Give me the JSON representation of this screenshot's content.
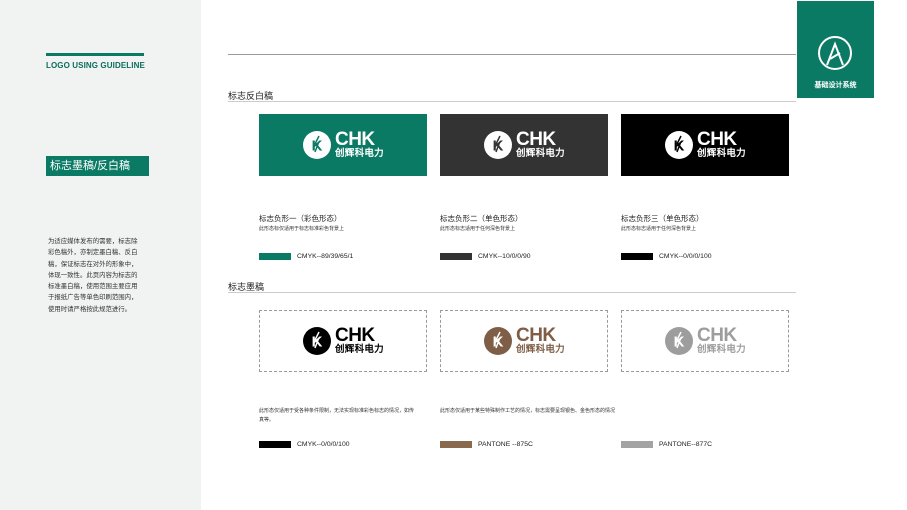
{
  "sidebar": {
    "guideline_title": "LOGO USING GUIDELINE",
    "section_tag": "标志墨稿/反白稿",
    "description_lines": [
      "为适应媒体发布的需要，标志除",
      "彩色稿外，亦制定墨白稿、反白",
      "稿，保证标志在对外的形象中，",
      "体现一致性。此页内容为标志的",
      "标准墨白稿，使用范围主要应用",
      "于报纸广告等单色印刷范围内，",
      "使用时请严格按此规范进行。"
    ]
  },
  "badge": {
    "label": "基础设计系统",
    "icon": "letter-a-circle-icon"
  },
  "logo": {
    "wordmark": "CHK",
    "cn_name": "创辉科电力"
  },
  "reverse_section": {
    "title": "标志反白稿",
    "cards": [
      {
        "bg": "#0b7a64",
        "fg": "#ffffff",
        "name": "标志负形一（彩色形态）",
        "note": "此形态标仅适用于标志标准彩色背景上",
        "swatch": "#0b7a64",
        "color_code": "CMYK--89/39/65/1"
      },
      {
        "bg": "#333333",
        "fg": "#ffffff",
        "name": "标志负形二（单色形态）",
        "note": "此形态标志适用于任何深色背景上",
        "swatch": "#333333",
        "color_code": "CMYK--10/0/0/90"
      },
      {
        "bg": "#000000",
        "fg": "#ffffff",
        "name": "标志负形三（单色形态）",
        "note": "此形态标志适用于任何深色背景上",
        "swatch": "#000000",
        "color_code": "CMYK--0/0/0/100"
      }
    ]
  },
  "ink_section": {
    "title": "标志墨稿",
    "cards": [
      {
        "fg": "#000000",
        "swatch": "#000000",
        "color_code": "CMYK--0/0/0/100"
      },
      {
        "fg": "#7e5e46",
        "swatch": "#8a6a4f",
        "color_code": "PANTONE --875C"
      },
      {
        "fg": "#9d9d9d",
        "swatch": "#a3a3a3",
        "color_code": "PANTONE--877C"
      }
    ],
    "note_left": "此形态仅适用于受各种条件限制，无法实现标准彩色标志的情况，如传真等。",
    "note_right": "此形态仅适用于某些特殊制作工艺的情况，标志需要呈现银色、金色形态的情况"
  }
}
